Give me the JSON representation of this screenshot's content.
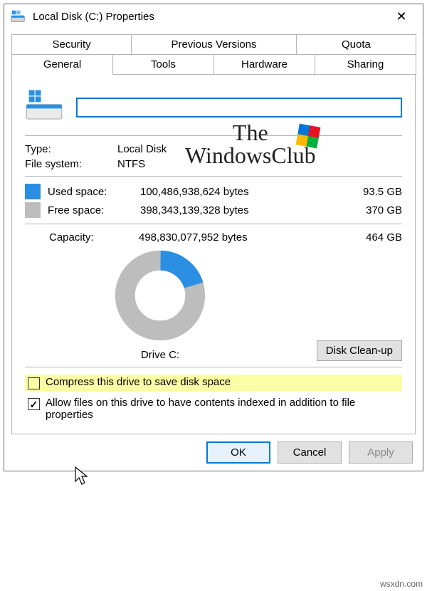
{
  "titlebar": {
    "title": "Local Disk (C:) Properties"
  },
  "tabs": {
    "row1": [
      "Security",
      "Previous Versions",
      "Quota"
    ],
    "row2": [
      "General",
      "Tools",
      "Hardware",
      "Sharing"
    ],
    "active": "General"
  },
  "general": {
    "name_value": "",
    "type_label": "Type:",
    "type_value": "Local Disk",
    "fs_label": "File system:",
    "fs_value": "NTFS",
    "used_label": "Used space:",
    "used_bytes": "100,486,938,624 bytes",
    "used_gb": "93.5 GB",
    "free_label": "Free space:",
    "free_bytes": "398,343,139,328 bytes",
    "free_gb": "370 GB",
    "capacity_label": "Capacity:",
    "capacity_bytes": "498,830,077,952 bytes",
    "capacity_gb": "464 GB",
    "drive_label": "Drive C:",
    "cleanup_button": "Disk Clean-up",
    "compress_label": "Compress this drive to save disk space",
    "compress_checked": false,
    "index_label": "Allow files on this drive to have contents indexed in addition to file properties",
    "index_checked": true
  },
  "buttons": {
    "ok": "OK",
    "cancel": "Cancel",
    "apply": "Apply"
  },
  "chart_data": {
    "type": "pie",
    "title": "Drive C:",
    "series": [
      {
        "name": "Used space",
        "value": 100486938624,
        "color": "#2a8fe3"
      },
      {
        "name": "Free space",
        "value": 398343139328,
        "color": "#bdbdbd"
      }
    ]
  },
  "watermark": {
    "line1": "The",
    "line2": "WindowsClub"
  },
  "source": "wsxdn.com"
}
